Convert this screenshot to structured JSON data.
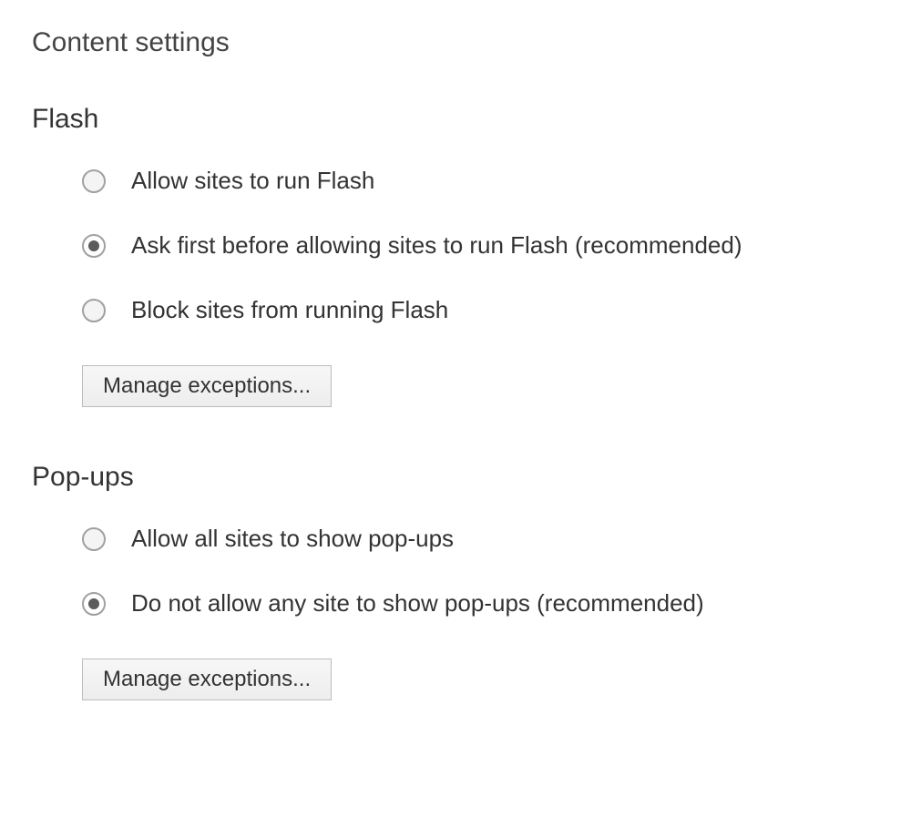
{
  "page_title": "Content settings",
  "sections": {
    "flash": {
      "heading": "Flash",
      "options": [
        {
          "label": "Allow sites to run Flash",
          "selected": false
        },
        {
          "label": "Ask first before allowing sites to run Flash (recommended)",
          "selected": true
        },
        {
          "label": "Block sites from running Flash",
          "selected": false
        }
      ],
      "button_label": "Manage exceptions..."
    },
    "popups": {
      "heading": "Pop-ups",
      "options": [
        {
          "label": "Allow all sites to show pop-ups",
          "selected": false
        },
        {
          "label": "Do not allow any site to show pop-ups (recommended)",
          "selected": true
        }
      ],
      "button_label": "Manage exceptions..."
    }
  }
}
